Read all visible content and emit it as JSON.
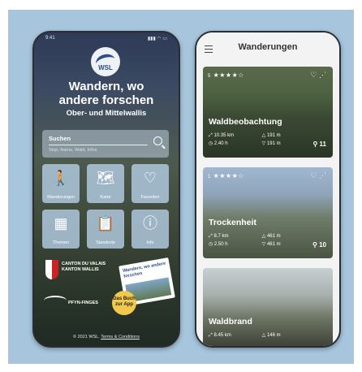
{
  "left_phone": {
    "status_time": "9:41",
    "status_icons": "▮▮▮ ◠ ▭",
    "logo_text": "WSL",
    "title_line1": "Wandern, wo",
    "title_line2": "andere forschen",
    "subtitle": "Ober- und Mittelwallis",
    "search": {
      "label": "Suchen",
      "placeholder": "Stop, Name, Wald, Infos"
    },
    "tiles": [
      {
        "label": "Wanderungen",
        "icon": "hiker-icon",
        "glyph": "🚶"
      },
      {
        "label": "Karte",
        "icon": "map-icon",
        "glyph": "🗺"
      },
      {
        "label": "Favoriten",
        "icon": "heart-icon",
        "glyph": "♡"
      },
      {
        "label": "Themen",
        "icon": "grid-icon",
        "glyph": "▦"
      },
      {
        "label": "Standorte",
        "icon": "clipboard-icon",
        "glyph": "📋"
      },
      {
        "label": "Info",
        "icon": "info-icon",
        "glyph": "ⓘ"
      }
    ],
    "canton_line1": "CANTON DU VALAIS",
    "canton_line2": "KANTON WALLIS",
    "pfyn_text": "PFYN-FINGES",
    "book_title": "Wandern, wo andere forschen",
    "badge_text": "Das Buch zur App",
    "footer_copyright": "© 2021 WSL.",
    "footer_link": "Terms & Conditions"
  },
  "right_phone": {
    "title": "Wanderungen",
    "cards": [
      {
        "rating_num": "5",
        "stars": "★★★★☆",
        "name": "Waldbeobachtung",
        "distance": "10.35 km",
        "ascent": "191 m",
        "duration": "2.40 h",
        "descent": "191 m",
        "points": "11"
      },
      {
        "rating_num": "1",
        "stars": "★★★★☆",
        "name": "Trockenheit",
        "distance": "8.7 km",
        "ascent": "461 m",
        "duration": "2.50 h",
        "descent": "461 m",
        "points": "10"
      },
      {
        "rating_num": "",
        "stars": "",
        "name": "Waldbrand",
        "distance": "8.45 km",
        "ascent": "146 m",
        "duration": "",
        "descent": "",
        "points": ""
      }
    ]
  }
}
